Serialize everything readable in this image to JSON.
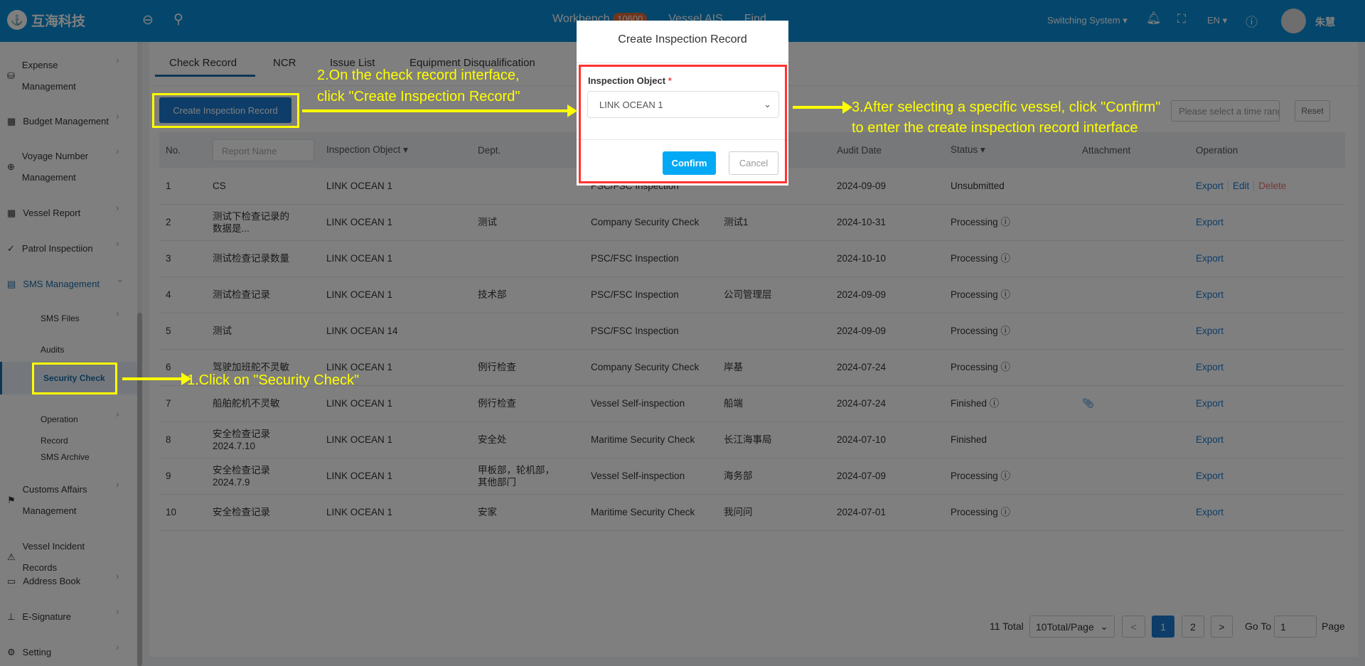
{
  "header": {
    "logo": "互海科技",
    "nav": [
      {
        "label": "Workbench",
        "badge": "10600"
      },
      {
        "label": "Vessel AIS"
      },
      {
        "label": "Find"
      }
    ],
    "switch": "Switching System",
    "lang": "EN",
    "user": "朱慧"
  },
  "sidebar": {
    "items": [
      {
        "label": "Expense Management",
        "icon": "database-icon",
        "chev": true
      },
      {
        "label": "Budget Management",
        "icon": "budget-icon",
        "chev": true
      },
      {
        "label": "Voyage Number Management",
        "icon": "globe-icon",
        "chev": true
      },
      {
        "label": "Vessel Report",
        "icon": "calendar-icon",
        "chev": true
      },
      {
        "label": "Patrol Inspectiion",
        "icon": "check-circle-icon",
        "chev": true
      },
      {
        "label": "SMS Management",
        "icon": "document-icon",
        "chev": "down"
      },
      {
        "label": "SMS Files",
        "chev": true
      },
      {
        "label": "Audits Management"
      },
      {
        "label": "Security Check",
        "active": true
      },
      {
        "label": "Operation Record",
        "chev": true
      },
      {
        "label": "SMS Archive"
      },
      {
        "label": "Customs Affairs Management",
        "icon": "customs-icon",
        "chev": true
      },
      {
        "label": "Vessel Incident Records",
        "icon": "warning-icon"
      },
      {
        "label": "Address Book",
        "icon": "address-book-icon",
        "chev": true
      },
      {
        "label": "E-Signature",
        "icon": "stamp-icon",
        "chev": true
      },
      {
        "label": "Setting",
        "icon": "gear-icon",
        "chev": true
      }
    ]
  },
  "tabs": [
    "Check Record",
    "NCR",
    "Issue List",
    "Equipment Disqualification"
  ],
  "toolbar": {
    "create": "Create Inspection Record",
    "date_placeholder": "Please select a time range.",
    "reset": "Reset"
  },
  "table": {
    "headers": [
      "No.",
      "Report Name",
      "Inspection Object",
      "Dept.",
      "Inspection Type",
      "Inspection Unit",
      "Audit Date",
      "Status",
      "Attachment",
      "Operation"
    ],
    "rows": [
      [
        "1",
        "CS",
        "LINK OCEAN 1",
        "",
        "PSC/FSC Inspection",
        "",
        "2024-09-09",
        "Unsubmitted",
        "",
        [
          "Export",
          "Edit",
          "Delete"
        ]
      ],
      [
        "2",
        "测试下检查记录的数据是...",
        "LINK OCEAN 1",
        "测试",
        "Company Security Check",
        "测试1",
        "2024-10-31",
        "Processing",
        "",
        [
          "Export"
        ]
      ],
      [
        "3",
        "测试检查记录数量",
        "LINK OCEAN 1",
        "",
        "PSC/FSC Inspection",
        "",
        "2024-10-10",
        "Processing",
        "",
        [
          "Export"
        ]
      ],
      [
        "4",
        "测试检查记录",
        "LINK OCEAN 1",
        "技术部",
        "PSC/FSC Inspection",
        "公司管理层",
        "2024-09-09",
        "Processing",
        "",
        [
          "Export"
        ]
      ],
      [
        "5",
        "测试",
        "LINK OCEAN 14",
        "",
        "PSC/FSC Inspection",
        "",
        "2024-09-09",
        "Processing",
        "",
        [
          "Export"
        ]
      ],
      [
        "6",
        "驾驶加班舵不灵敏",
        "LINK OCEAN 1",
        "例行检查",
        "Company Security Check",
        "岸基",
        "2024-07-24",
        "Processing",
        "",
        [
          "Export"
        ]
      ],
      [
        "7",
        "船舶舵机不灵敏",
        "LINK OCEAN 1",
        "例行检查",
        "Vessel Self-inspection",
        "船端",
        "2024-07-24",
        "Finished",
        "paperclip",
        [
          "Export"
        ]
      ],
      [
        "8",
        "安全检查记录2024.7.10",
        "LINK OCEAN 1",
        "安全处",
        "Maritime Security Check",
        "长江海事局",
        "2024-07-10",
        "Finished",
        "",
        [
          "Export"
        ]
      ],
      [
        "9",
        "安全检查记录2024.7.9",
        "LINK OCEAN 1",
        "甲板部，轮机部，其他部门",
        "Vessel Self-inspection",
        "海务部",
        "2024-07-09",
        "Processing",
        "",
        [
          "Export"
        ]
      ],
      [
        "10",
        "安全检查记录",
        "LINK OCEAN 1",
        "安家",
        "Maritime Security Check",
        "我问问",
        "2024-07-01",
        "Processing",
        "",
        [
          "Export"
        ]
      ]
    ]
  },
  "pagination": {
    "total": "11 Total",
    "per_page": "10Total/Page",
    "prev": "<",
    "pages": [
      "1",
      "2"
    ],
    "current": "1",
    "next": ">",
    "goto": "Go To",
    "goto_value": "1",
    "page": "Page"
  },
  "modal": {
    "title": "Create Inspection Record",
    "label": "Inspection Object",
    "required": "*",
    "value": "LINK OCEAN 1",
    "confirm": "Confirm",
    "cancel": "Cancel"
  },
  "annotations": {
    "step1": "1.Click on \"Security Check\"",
    "step2a": "2.On the check record interface,",
    "step2b": "click \"Create Inspection Record\"",
    "step3a": "3.After selecting a specific vessel, click \"Confirm\"",
    "step3b": "to enter the create inspection record interface"
  },
  "colors": {
    "header": "#0a8fd8",
    "primary": "#1a7bd0",
    "confirm": "#03a9f4",
    "annotation": "#ffff00",
    "highlight": "#ff3333"
  }
}
